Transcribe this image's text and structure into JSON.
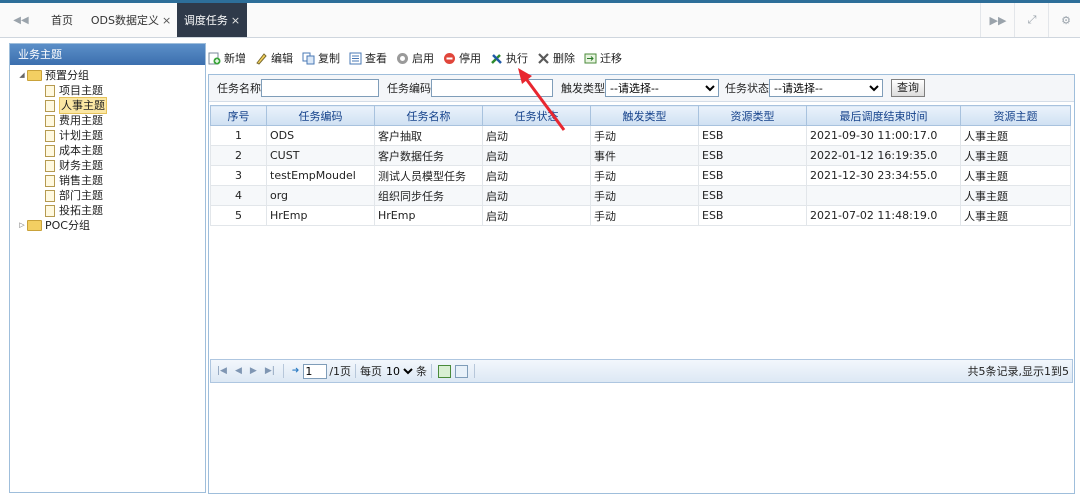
{
  "tabs": [
    {
      "label": "首页",
      "closable": false,
      "active": false
    },
    {
      "label": "ODS数据定义",
      "closable": true,
      "active": false
    },
    {
      "label": "调度任务",
      "closable": true,
      "active": true
    }
  ],
  "close_glyph": "×",
  "sidebar": {
    "title": "业务主题",
    "groups": [
      {
        "label": "预置分组",
        "expanded": true,
        "items": [
          "项目主题",
          "人事主题",
          "费用主题",
          "计划主题",
          "成本主题",
          "财务主题",
          "销售主题",
          "部门主题",
          "投拓主题"
        ],
        "selected": "人事主题"
      },
      {
        "label": "POC分组",
        "expanded": false,
        "items": []
      }
    ]
  },
  "toolbar": {
    "buttons": [
      {
        "label": "新增",
        "icon": "add-icon"
      },
      {
        "label": "编辑",
        "icon": "edit-icon"
      },
      {
        "label": "复制",
        "icon": "copy-icon"
      },
      {
        "label": "查看",
        "icon": "view-icon"
      },
      {
        "label": "启用",
        "icon": "enable-icon"
      },
      {
        "label": "停用",
        "icon": "disable-icon"
      },
      {
        "label": "执行",
        "icon": "execute-icon"
      },
      {
        "label": "删除",
        "icon": "delete-icon"
      },
      {
        "label": "迁移",
        "icon": "migrate-icon"
      }
    ]
  },
  "search": {
    "task_name_label": "任务名称",
    "task_name_value": "",
    "task_code_label": "任务编码",
    "task_code_value": "",
    "trigger_type_label": "触发类型",
    "trigger_type_selected": "--请选择--",
    "task_status_label": "任务状态",
    "task_status_selected": "--请选择--",
    "query_button": "查询"
  },
  "grid": {
    "columns": [
      "序号",
      "任务编码",
      "任务名称",
      "任务状态",
      "触发类型",
      "资源类型",
      "最后调度结束时间",
      "资源主题"
    ],
    "rows": [
      [
        "1",
        "ODS",
        "客户抽取",
        "启动",
        "手动",
        "ESB",
        "2021-09-30 11:00:17.0",
        "人事主题"
      ],
      [
        "2",
        "CUST",
        "客户数据任务",
        "启动",
        "事件",
        "ESB",
        "2022-01-12 16:19:35.0",
        "人事主题"
      ],
      [
        "3",
        "testEmpMoudel",
        "测试人员模型任务",
        "启动",
        "手动",
        "ESB",
        "2021-12-30 23:34:55.0",
        "人事主题"
      ],
      [
        "4",
        "org",
        "组织同步任务",
        "启动",
        "手动",
        "ESB",
        "",
        "人事主题"
      ],
      [
        "5",
        "HrEmp",
        "HrEmp",
        "启动",
        "手动",
        "ESB",
        "2021-07-02 11:48:19.0",
        "人事主题"
      ]
    ]
  },
  "pager": {
    "page_value": "1",
    "total_pages_text": "/1页",
    "per_page_label": "每页",
    "per_page_value": "10",
    "per_page_unit": "条",
    "summary": "共5条记录,显示1到5"
  },
  "colors": {
    "accent": "#2f3a4a",
    "header_blue": "#3c6fae",
    "arrow_red": "#e8262f"
  }
}
